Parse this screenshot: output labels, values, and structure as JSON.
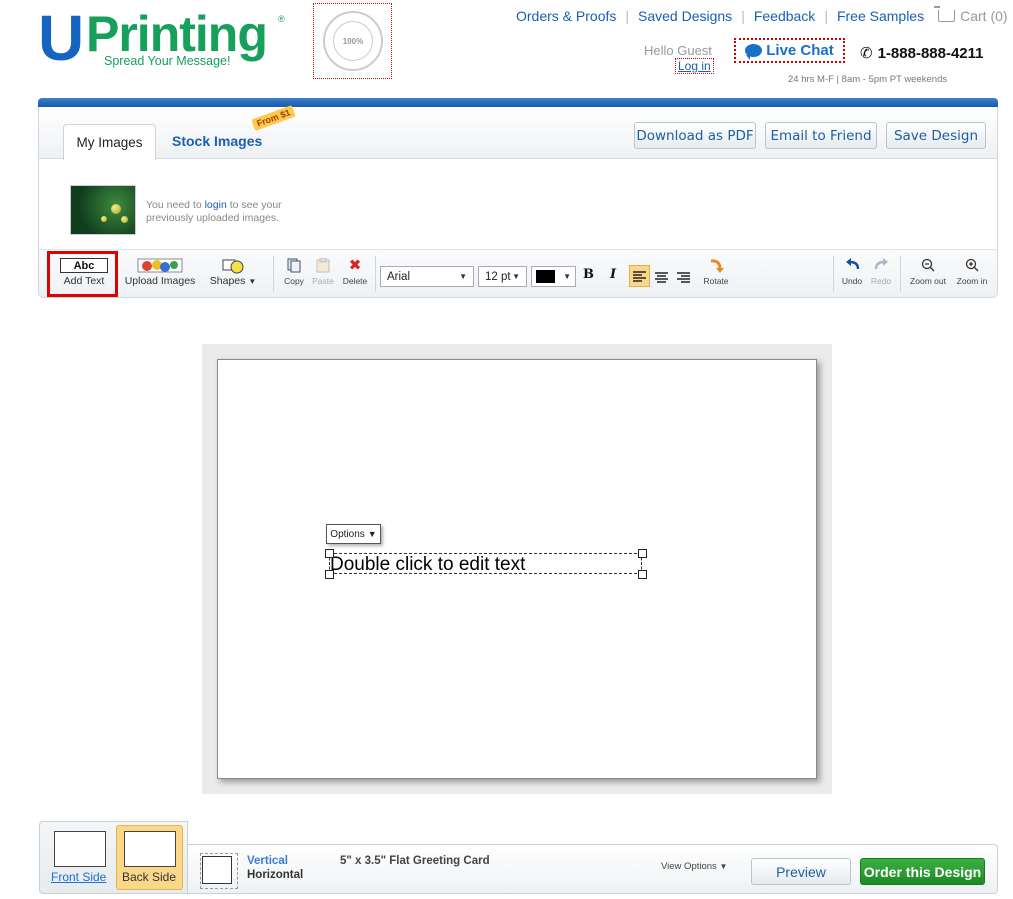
{
  "header": {
    "logo_letter": "U",
    "logo_word": "Printing",
    "logo_reg": "®",
    "tagline": "Spread Your Message!",
    "seal_text": "QUALITY",
    "seal_center": "100%",
    "seal_bottom": "GUARANTEE",
    "links": [
      "Orders & Proofs",
      "Saved Designs",
      "Feedback",
      "Free Samples"
    ],
    "cart_label": "Cart (0)",
    "greeting": "Hello Guest",
    "login_label": "Log in",
    "live_chat_label": "Live Chat",
    "phone": "1-888-888-4211",
    "hours": "24 hrs M-F  |  8am - 5pm PT weekends"
  },
  "editor": {
    "tabs": {
      "my_images": "My Images",
      "stock_images": "Stock Images",
      "stock_badge": "From $1"
    },
    "actions": {
      "download_pdf": "Download as PDF",
      "email_friend": "Email to Friend",
      "save_design": "Save Design"
    },
    "login_msg_pre": "You need to",
    "login_msg_link": "login",
    "login_msg_post": "to see your previously uploaded images.",
    "toolbar": {
      "add_text_icon": "Abc",
      "add_text": "Add Text",
      "upload_images": "Upload Images",
      "shapes": "Shapes",
      "copy": "Copy",
      "paste": "Paste",
      "delete": "Delete",
      "font": "Arial",
      "font_size": "12 pt",
      "bold": "B",
      "italic": "I",
      "rotate": "Rotate",
      "undo": "Undo",
      "redo": "Redo",
      "zoom_out": "Zoom out",
      "zoom_in": "Zoom in"
    },
    "colors": {
      "accent": "#1a5fb4",
      "brand_green": "#16a05a",
      "highlight": "#e00000",
      "text_color": "#000000"
    }
  },
  "canvas": {
    "options_label": "Options",
    "text_placeholder": "Double click to edit text"
  },
  "footer": {
    "front_side": "Front Side",
    "back_side": "Back Side",
    "orientation_vertical": "Vertical",
    "orientation_horizontal": "Horizontal",
    "product": "5\" x 3.5\" Flat Greeting Card",
    "view_options": "View Options",
    "preview": "Preview",
    "order": "Order this Design"
  }
}
